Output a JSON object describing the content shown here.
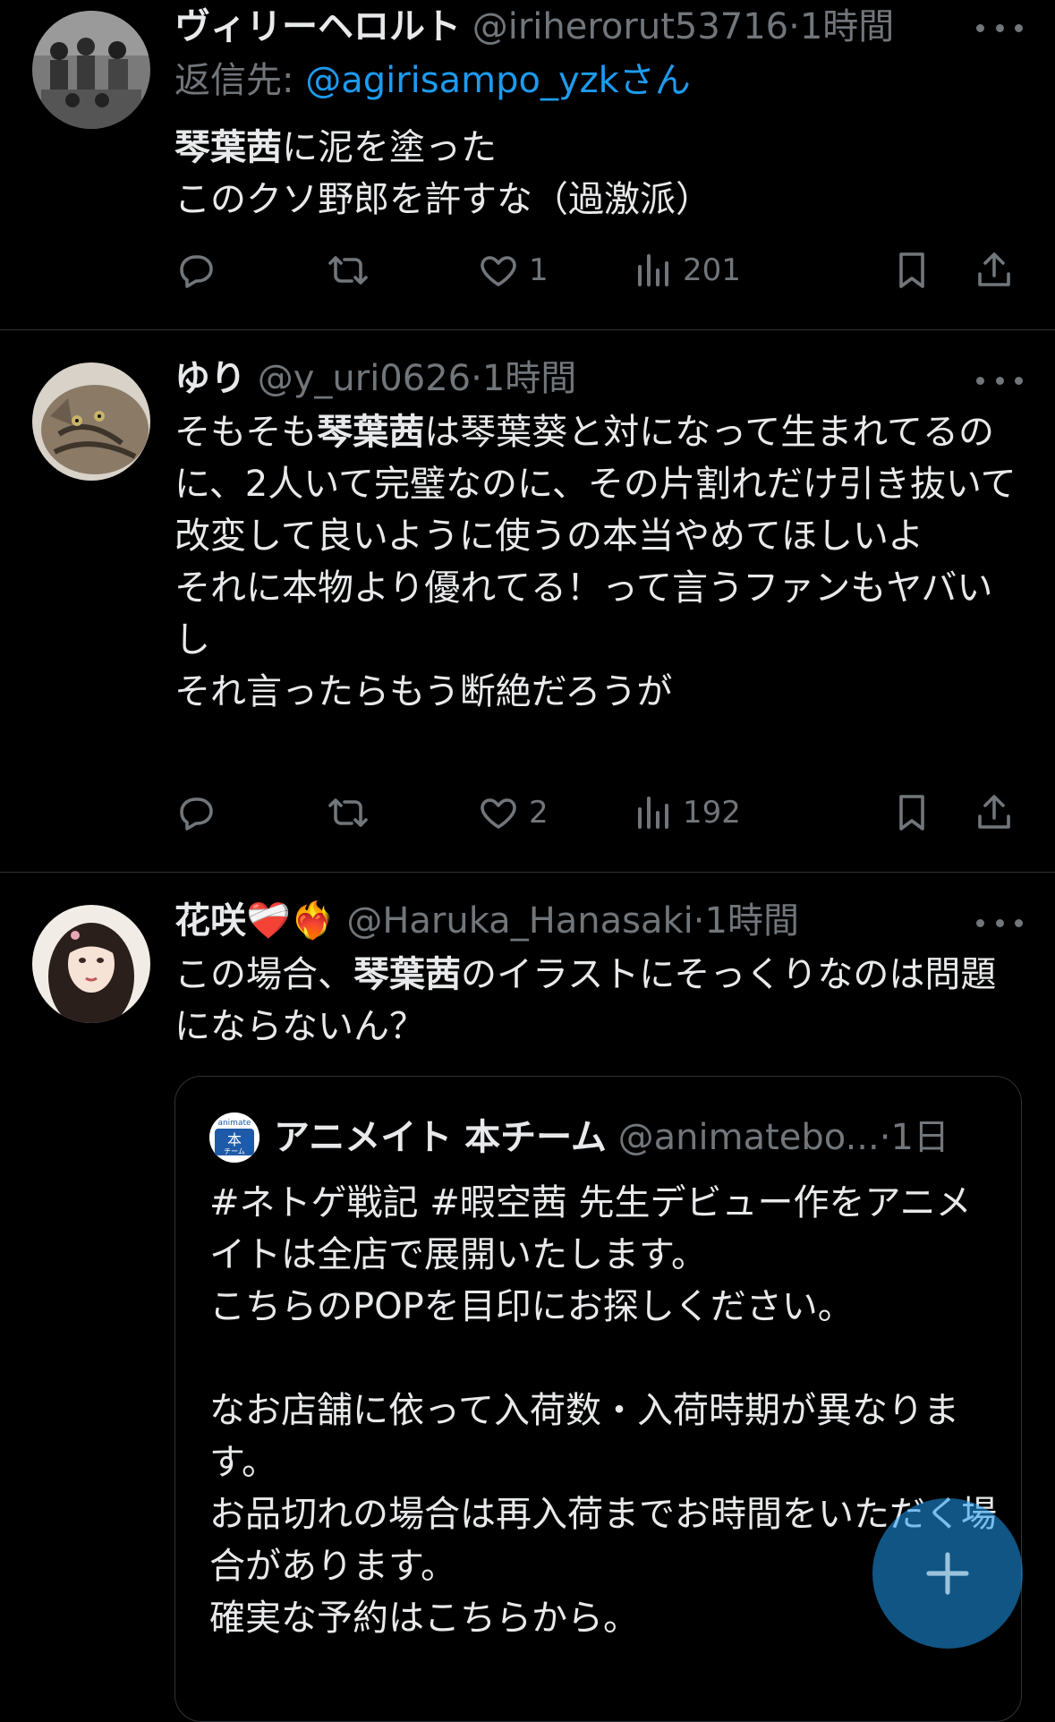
{
  "colors": {
    "background": "#000000",
    "text": "#e7e9ea",
    "secondary": "#71767b",
    "accent": "#1d9bf0",
    "divider": "#2f3336"
  },
  "tweets": [
    {
      "name": "ヴィリーヘロルト",
      "handle": "@iriherorut53716",
      "dot": "·",
      "time": "1時間",
      "reply_prefix": "返信先: ",
      "reply_to": "@agirisampo_yzk",
      "reply_suffix": "さん",
      "body_bold": "琴葉茜",
      "body_rest": "に泥を塗った\nこのクソ野郎を許すな（過激派）",
      "likes": "1",
      "views": "201",
      "avatar_icon": "group-photo-avatar"
    },
    {
      "name": "ゆり",
      "handle": "@y_uri0626",
      "dot": "·",
      "time": "1時間",
      "body_pre": "そもそも",
      "body_bold": "琴葉茜",
      "body_rest": "は琴葉葵と対になって生まれてるのに、2人いて完璧なのに、その片割れだけ引き抜いて改変して良いように使うの本当やめてほしいよ\nそれに本物より優れてる！って言うファンもヤバいし\nそれ言ったらもう断絶だろうが",
      "likes": "2",
      "views": "192",
      "avatar_icon": "cat-avatar"
    },
    {
      "name": "花咲",
      "name_emoji": "❤️‍🩹❤️‍🔥",
      "handle": "@Haruka_Hanasaki",
      "dot": "·",
      "time": "1時間",
      "body_pre": "この場合、",
      "body_bold": "琴葉茜",
      "body_rest": "のイラストにそっくりなのは問題にならないん？",
      "avatar_icon": "anime-girl-avatar",
      "quote": {
        "name": "アニメイト 本チーム",
        "handle": "@animatebo...",
        "dot": "·",
        "time": "1日",
        "avatar_icon": "animate-logo-avatar",
        "avatar_text_top": "animate",
        "avatar_text_mid": "本",
        "avatar_text_bot": "チーム",
        "body": "#ネトゲ戦記 #暇空茜 先生デビュー作をアニメイトは全店で展開いたします。\nこちらのPOPを目印にお探しください。\n\nなお店舗に依って入荷数・入荷時期が異なります。\nお品切れの場合は再入荷までお時間をいただく場合があります。\n確実な予約はこちらから。"
      }
    }
  ],
  "fab_icon": "plus-icon"
}
